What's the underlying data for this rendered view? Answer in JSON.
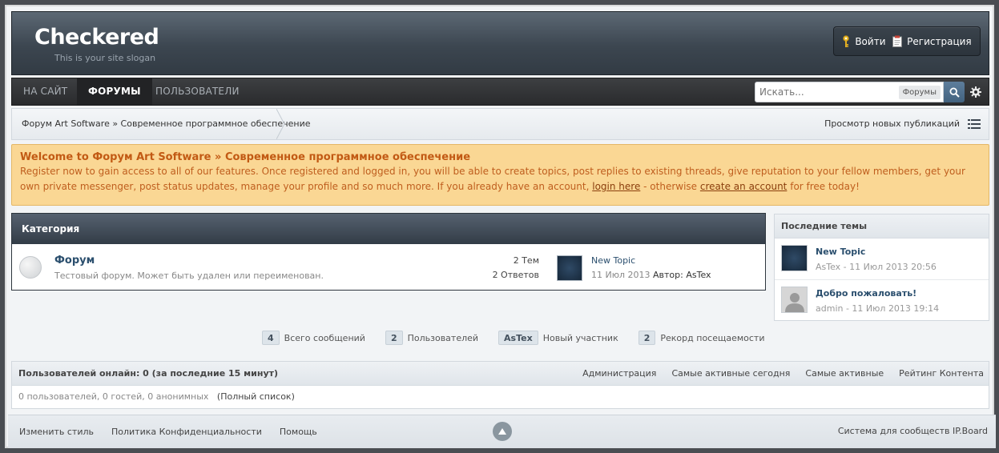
{
  "header": {
    "logo": "Checkered",
    "slogan": "This is your site slogan",
    "login": "Войти",
    "register": "Регистрация"
  },
  "nav": {
    "tabs": [
      {
        "label": "НА САЙТ"
      },
      {
        "label": "ФОРУМЫ"
      },
      {
        "label": "ПОЛЬЗОВАТЕЛИ"
      }
    ],
    "active_tab": "ФОРУМЫ",
    "search_placeholder": "Искать...",
    "search_scope": "Форумы"
  },
  "breadcrumb": {
    "path": "Форум Art Software » Современное программное обеспечение",
    "new_posts": "Просмотр новых публикаций"
  },
  "welcome": {
    "title": "Welcome to Форум Art Software » Современное программное обеспечение",
    "text1": "Register now to gain access to all of our features. Once registered and logged in, you will be able to create topics, post replies to existing threads, give reputation to your fellow members, get your own private messenger, post status updates, manage your profile and so much more. If you already have an account,",
    "login_link": "login here",
    "text2": "- otherwise",
    "create_link": "create an account",
    "text3": "for free today!"
  },
  "category": {
    "title": "Категория",
    "forum": {
      "name": "Форум",
      "description": "Тестовый форум. Может быть удален или переименован.",
      "topics": "2 Тем",
      "replies": "2 Ответов",
      "last_topic": "New Topic",
      "last_date": "11 Июл 2013",
      "last_author_label": "Автор: AsTex"
    }
  },
  "sidebar": {
    "title": "Последние темы",
    "items": [
      {
        "title": "New Topic",
        "meta": "AsTex - 11 Июл 2013 20:56"
      },
      {
        "title": "Добро пожаловать!",
        "meta": "admin - 11 Июл 2013 19:14"
      }
    ]
  },
  "stats": [
    {
      "value": "4",
      "label": "Всего сообщений"
    },
    {
      "value": "2",
      "label": "Пользователей"
    },
    {
      "value": "AsTex",
      "label": "Новый участник"
    },
    {
      "value": "2",
      "label": "Рекорд посещаемости"
    }
  ],
  "online": {
    "title": "Пользователей онлайн: 0 (за последние 15 минут)",
    "links": [
      "Администрация",
      "Самые активные сегодня",
      "Самые активные",
      "Рейтинг Контента"
    ],
    "summary": "0 пользователей, 0 гостей, 0 анонимных",
    "full_list": "(Полный список)"
  },
  "footer": {
    "links": [
      "Изменить стиль",
      "Политика Конфиденциальности",
      "Помощь"
    ],
    "copyright": "Система для сообществ IP.Board"
  },
  "colors": {
    "accent": "#42627f",
    "welcome_bg": "#fad794",
    "welcome_text": "#bf5e1e"
  }
}
